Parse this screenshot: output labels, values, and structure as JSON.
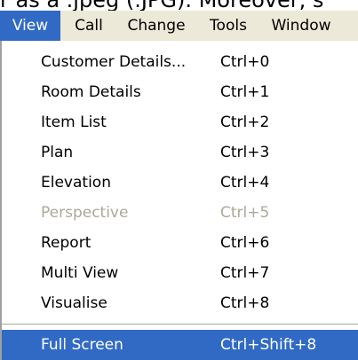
{
  "background_text": "r as a .jpeg (.JPG). Moreover, s",
  "menubar": {
    "items": [
      "View",
      "Call",
      "Change",
      "Tools",
      "Window"
    ],
    "active": "View"
  },
  "view_menu": {
    "items": [
      {
        "label": "Customer Details...",
        "shortcut": "Ctrl+0",
        "enabled": true
      },
      {
        "label": "Room Details",
        "shortcut": "Ctrl+1",
        "enabled": true
      },
      {
        "label": "Item List",
        "shortcut": "Ctrl+2",
        "enabled": true
      },
      {
        "label": "Plan",
        "shortcut": "Ctrl+3",
        "enabled": true
      },
      {
        "label": "Elevation",
        "shortcut": "Ctrl+4",
        "enabled": true
      },
      {
        "label": "Perspective",
        "shortcut": "Ctrl+5",
        "enabled": false
      },
      {
        "label": "Report",
        "shortcut": "Ctrl+6",
        "enabled": true
      },
      {
        "label": "Multi View",
        "shortcut": "Ctrl+7",
        "enabled": true
      },
      {
        "label": "Visualise",
        "shortcut": "Ctrl+8",
        "enabled": true
      }
    ],
    "last_item": {
      "label": "Full Screen",
      "shortcut": "Ctrl+Shift+8",
      "enabled": true,
      "highlighted": true
    }
  },
  "colors": {
    "menubar_bg": "#ece9d8",
    "highlight": "#316ac5",
    "disabled_text": "#aca899"
  }
}
